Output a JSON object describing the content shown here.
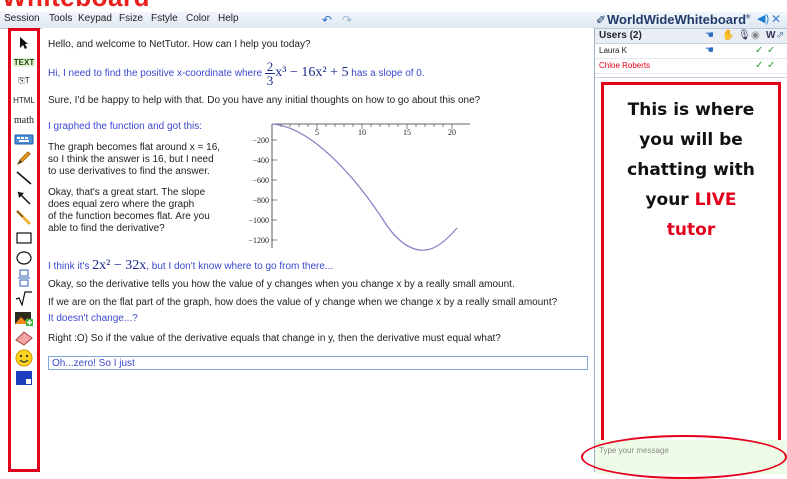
{
  "title_fragment": "Whiteboard",
  "menu": [
    "Session",
    "Tools",
    "Keypad",
    "Fsize",
    "Fstyle",
    "Color",
    "Help"
  ],
  "undo_icons": [
    "undo-icon",
    "redo-icon"
  ],
  "toolbar": {
    "tools": [
      {
        "name": "pointer-tool",
        "icon": "arrow-pointer-icon"
      },
      {
        "name": "text-tool",
        "label": "TEXT"
      },
      {
        "name": "paste-text-tool",
        "label": "⎘T"
      },
      {
        "name": "html-tool",
        "label": "HTML"
      },
      {
        "name": "math-tool",
        "label": "math"
      },
      {
        "name": "keyboard-tool",
        "icon": "keyboard-icon"
      },
      {
        "name": "pen-tool",
        "icon": "pencil-icon"
      },
      {
        "name": "line-tool",
        "icon": "line-icon"
      },
      {
        "name": "arrow-tool",
        "icon": "arrow-icon"
      },
      {
        "name": "highlighter-tool",
        "icon": "highlighter-icon"
      },
      {
        "name": "rectangle-tool",
        "icon": "rectangle-icon"
      },
      {
        "name": "ellipse-tool",
        "icon": "ellipse-icon"
      },
      {
        "name": "division-tool",
        "icon": "division-icon"
      },
      {
        "name": "sqrt-tool",
        "icon": "square-root-icon"
      },
      {
        "name": "image-tool",
        "icon": "image-icon"
      },
      {
        "name": "eraser-tool",
        "icon": "eraser-icon"
      },
      {
        "name": "smiley-tool",
        "icon": "smiley-icon"
      },
      {
        "name": "color-tool",
        "icon": "color-picker-icon"
      }
    ]
  },
  "chat": {
    "l1": "Hello, and welcome to NetTutor. How can I help you today?",
    "l2_pre": "Hi, I need to find the positive x-coordinate where",
    "l2_frac_num": "2",
    "l2_frac_den": "3",
    "l2_expr": "x³ − 16x² + 5",
    "l2_post": "has a slope of 0.",
    "l3": "Sure, I'd be happy to help with that. Do you have any initial thoughts on how to go about this one?",
    "l4": "I graphed the function and got this:",
    "l5": [
      "The graph becomes flat around x = 16,",
      "so I think the answer is 16, but I need",
      "to use derivatives to find the answer."
    ],
    "l6": [
      "Okay, that's a great start. The slope",
      "does equal zero where the graph",
      "of the function becomes flat. Are you",
      "able to find the derivative?"
    ],
    "l7_pre": "I think it's",
    "l7_expr": "2x² − 32x",
    "l7_post": ", but I don't know where to go from there...",
    "l8": "Okay, so the derivative tells you how the value of y changes when you change x by a really small amount.",
    "l9": "If we are on the flat part of the graph, how does the value of y change when we change x by a really small amount?",
    "l10": "It doesn't change...?",
    "l11": "Right :O)  So if the value of the derivative equals that change in y, then the derivative must equal what?",
    "input": "Oh...zero! So I just"
  },
  "graph": {
    "x_ticks": [
      "5",
      "10",
      "15",
      "20"
    ],
    "y_ticks": [
      "−200",
      "−400",
      "−600",
      "−800",
      "−1000",
      "−1200"
    ]
  },
  "right": {
    "brand": "WorldWideWhiteboard",
    "brand_mark": "®",
    "users_title": "Users (2)",
    "col_w": "W",
    "users": [
      {
        "name": "Laura K",
        "color": "#222222",
        "checks": [
          "✓",
          "✓"
        ]
      },
      {
        "name": "Chloe Roberts",
        "color": "#e3001b",
        "checks": [
          "✓",
          "✓"
        ]
      }
    ],
    "note_lines": [
      "This is where",
      "you will be",
      "chatting with"
    ],
    "note_your": "your",
    "note_live": "LIVE",
    "note_tutor": "tutor",
    "msg_placeholder": "Type your message"
  },
  "colors": {
    "annotation_red": "#e3001b",
    "student_blue": "#3b48cf",
    "curve": "#8a86c8"
  }
}
